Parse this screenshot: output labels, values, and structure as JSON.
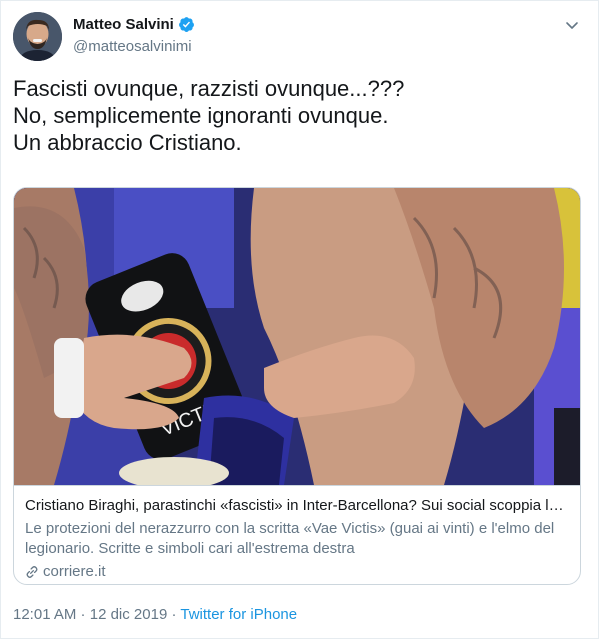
{
  "user": {
    "name": "Matteo Salvini",
    "handle": "@matteosalvinimi",
    "verified": true
  },
  "tweet": {
    "lines": [
      "Fascisti ovunque, razzisti ovunque...???",
      "No, semplicemente ignoranti ovunque.",
      "Un abbraccio Cristiano."
    ]
  },
  "card": {
    "title": "Cristiano Biraghi, parastinchi «fascisti» in Inter-Barcellona? Sui social scoppia la b...",
    "description": "Le protezioni del nerazzurro con la scritta «Vae Victis» (guai ai vinti) e l'elmo del legionario. Scritte e simboli cari all'estrema destra",
    "domain": "corriere.it",
    "image_text": "VICTIS"
  },
  "meta": {
    "time": "12:01 AM",
    "separator1": " · ",
    "date": "12 dic 2019",
    "separator2": " · ",
    "source": "Twitter for iPhone"
  },
  "icons": {
    "verified": "verified-badge-icon",
    "chevron": "chevron-down-icon",
    "link": "link-icon"
  },
  "colors": {
    "accent": "#1da1f2",
    "text": "#14171a",
    "secondary": "#657786",
    "border": "#ccd6dd",
    "link": "#1b95e0"
  }
}
